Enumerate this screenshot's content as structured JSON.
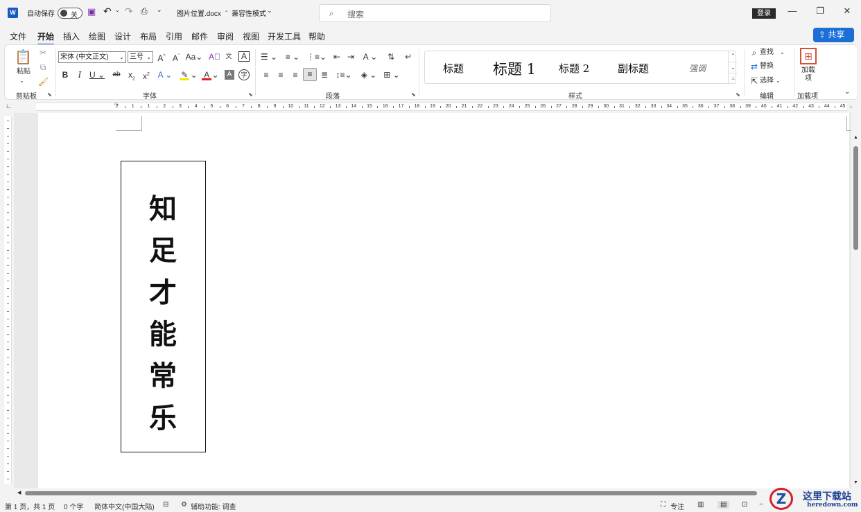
{
  "app": {
    "logo": "W",
    "autosave_label": "自动保存",
    "autosave_state": "关",
    "filename": "图片位置.docx",
    "mode": "兼容性模式",
    "search_placeholder": "搜索",
    "login": "登录",
    "share": "共享"
  },
  "menu": [
    "文件",
    "开始",
    "插入",
    "绘图",
    "设计",
    "布局",
    "引用",
    "邮件",
    "审阅",
    "视图",
    "开发工具",
    "帮助"
  ],
  "ribbon": {
    "clipboard": {
      "paste": "粘贴",
      "label": "剪贴板"
    },
    "font": {
      "name": "宋体 (中文正文)",
      "size": "三号",
      "label": "字体"
    },
    "paragraph": {
      "label": "段落"
    },
    "styles": {
      "label": "样式",
      "items": [
        "标题",
        "标题 1",
        "标题 2",
        "副标题",
        "强调"
      ]
    },
    "editing": {
      "find": "查找",
      "replace": "替换",
      "select": "选择",
      "label": "编辑"
    },
    "addins": {
      "button": "加载项",
      "label": "加载项"
    }
  },
  "ruler_numbers": [
    "2",
    "1",
    "1",
    "2",
    "3",
    "4",
    "5",
    "6",
    "7",
    "8",
    "9",
    "10",
    "11",
    "12",
    "13",
    "14",
    "15",
    "16",
    "17",
    "18",
    "19",
    "20",
    "21",
    "22",
    "23",
    "24",
    "25",
    "26",
    "27",
    "28",
    "29",
    "30",
    "31",
    "32",
    "33",
    "34",
    "35",
    "36",
    "37",
    "38",
    "39",
    "40",
    "41",
    "42",
    "43",
    "44",
    "45",
    "46"
  ],
  "document": {
    "textbox_chars": [
      "知",
      "足",
      "才",
      "能",
      "常",
      "乐"
    ]
  },
  "status": {
    "page": "第 1 页，共 1 页",
    "words": "0 个字",
    "language": "简体中文(中国大陆)",
    "accessibility": "辅助功能: 调查",
    "focus": "专注"
  },
  "watermark": {
    "letter": "Z",
    "title": "这里下载站",
    "url": "heredown.com"
  },
  "colors": {
    "accent": "#185abd",
    "share": "#1c6fd6",
    "highlight": "#f5e400",
    "font_color": "#e0201e"
  }
}
